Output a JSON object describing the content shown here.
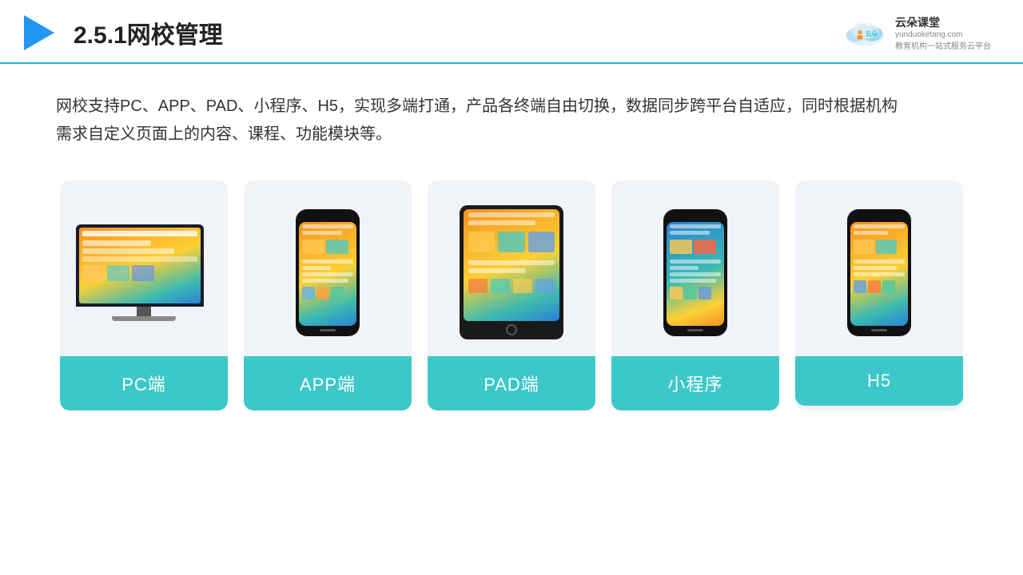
{
  "header": {
    "title": "2.5.1网校管理",
    "logo_name": "云朵课堂",
    "logo_domain": "yunduoketang.com",
    "logo_tagline": "教育机构一站\n式服务云平台"
  },
  "description": {
    "text": "网校支持PC、APP、PAD、小程序、H5，实现多端打通，产品各终端自由切换，数据同步跨平台自适应，同时根据机构需求自定义页面上的内容、课程、功能模块等。"
  },
  "cards": [
    {
      "id": "pc",
      "label": "PC端",
      "device": "pc"
    },
    {
      "id": "app",
      "label": "APP端",
      "device": "phone"
    },
    {
      "id": "pad",
      "label": "PAD端",
      "device": "tablet"
    },
    {
      "id": "miniapp",
      "label": "小程序",
      "device": "phone"
    },
    {
      "id": "h5",
      "label": "H5",
      "device": "phone"
    }
  ],
  "accent_color": "#3cc8c8",
  "title_color": "#222222"
}
